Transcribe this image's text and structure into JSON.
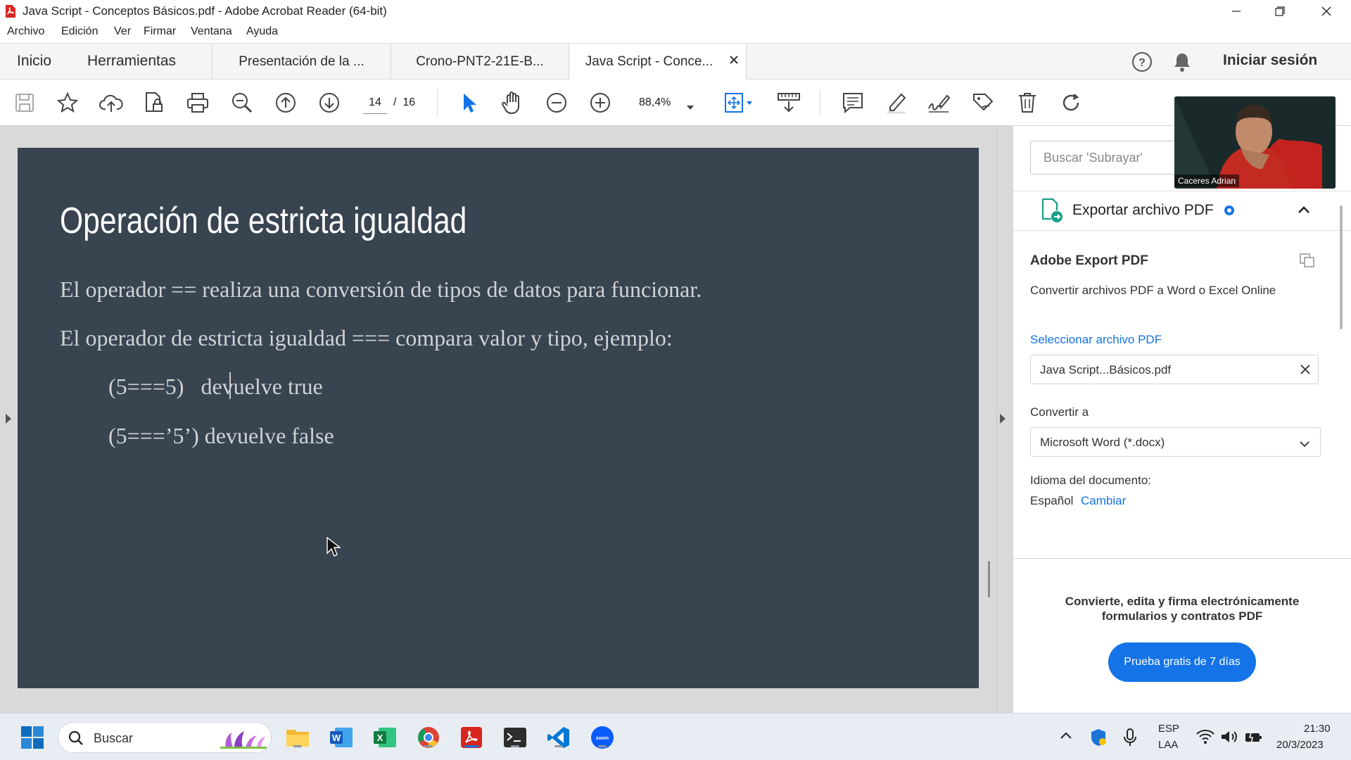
{
  "window": {
    "title": "Java Script - Conceptos Básicos.pdf - Adobe Acrobat Reader (64-bit)"
  },
  "menu": [
    "Archivo",
    "Edición",
    "Ver",
    "Firmar",
    "Ventana",
    "Ayuda"
  ],
  "nav_tabs": {
    "home": "Inicio",
    "tools": "Herramientas"
  },
  "doc_tabs": [
    {
      "label": "Presentación de la ..."
    },
    {
      "label": "Crono-PNT2-21E-B..."
    },
    {
      "label": "Java Script - Conce..."
    }
  ],
  "header_right": {
    "signin": "Iniciar sesión"
  },
  "toolbar": {
    "page_current": "14",
    "page_total": "/  16",
    "zoom": "88,4%"
  },
  "slide": {
    "title": "Operación de estricta igualdad",
    "line1": "El operador == realiza una conversión de tipos de datos para funcionar.",
    "line2": "El operador de estricta igualdad === compara valor y tipo, ejemplo:",
    "example1": "(5===5)   devuelve true",
    "example2": "(5===’5’) devuelve false"
  },
  "right_panel": {
    "search_placeholder": "Buscar 'Subrayar'",
    "export_header": "Exportar archivo PDF",
    "section_title": "Adobe Export PDF",
    "section_desc": "Convertir archivos PDF a Word o Excel Online",
    "select_link": "Seleccionar archivo PDF",
    "selected_file": "Java Script...Básicos.pdf",
    "convert_label": "Convertir a",
    "convert_value": "Microsoft Word (*.docx)",
    "language_label": "Idioma del documento:",
    "language_value": "Español",
    "change_link": "Cambiar",
    "promo_text": "Convierte, edita y firma electrónicamente formularios y contratos PDF",
    "trial_button": "Prueba gratis de 7 días"
  },
  "video_overlay": {
    "name": "Caceres Adrian"
  },
  "taskbar": {
    "search_label": "Buscar",
    "lang_top": "ESP",
    "lang_bottom": "LAA",
    "time": "21:30",
    "date": "20/3/2023"
  },
  "colors": {
    "slide_bg": "#384450",
    "accent_blue": "#1473e6",
    "trial_button": "#1473e6"
  }
}
